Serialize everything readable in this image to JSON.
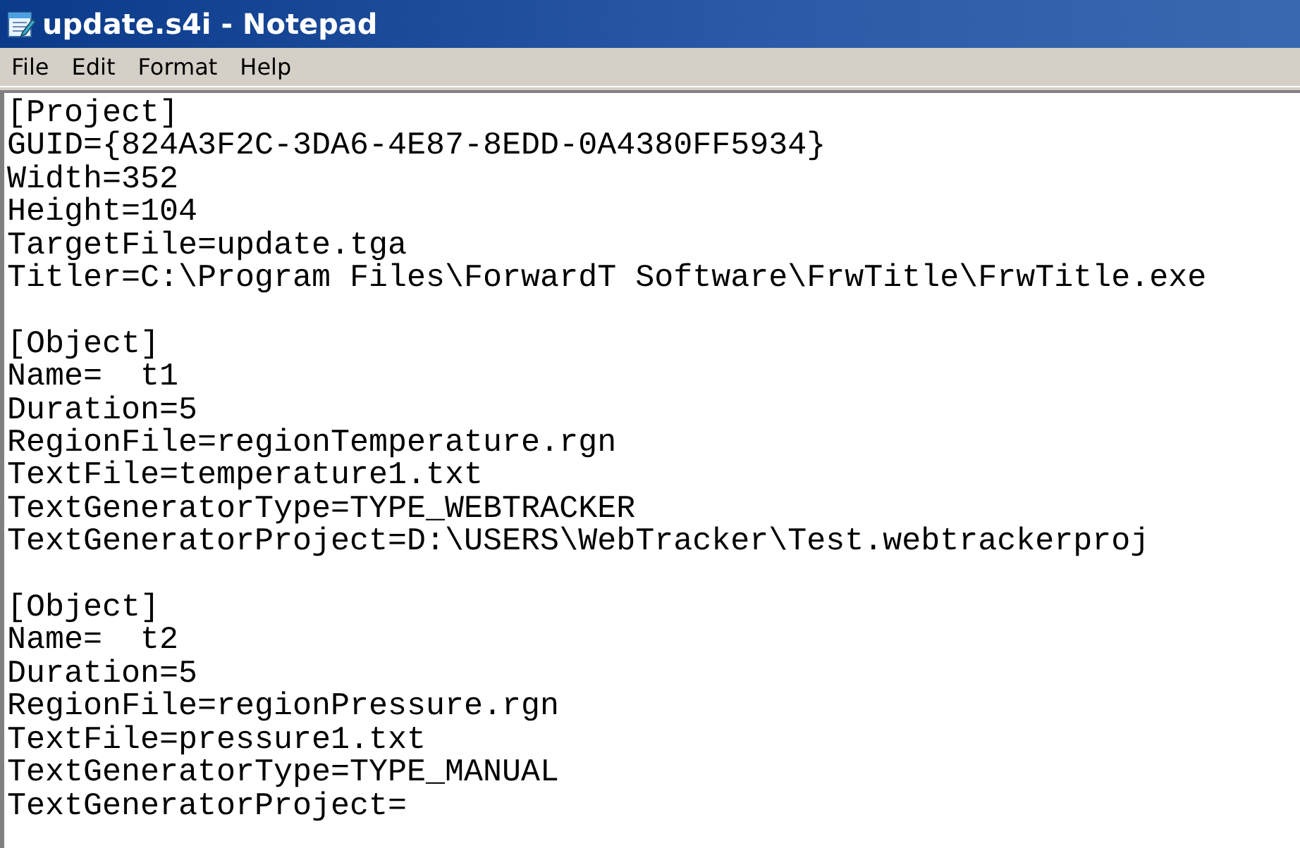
{
  "window": {
    "title": "update.s4i - Notepad"
  },
  "menu": [
    "File",
    "Edit",
    "Format",
    "Help"
  ],
  "sections": [
    {
      "lines": [
        "[Project]",
        "GUID={824A3F2C-3DA6-4E87-8EDD-0A4380FF5934}",
        "Width=352",
        "Height=104",
        "TargetFile=update.tga",
        "Titler=C:\\Program Files\\ForwardT Software\\FrwTitle\\FrwTitle.exe"
      ]
    },
    {
      "lines": [
        "[Object]",
        "Name=  t1",
        "Duration=5",
        "RegionFile=regionTemperature.rgn",
        "TextFile=temperature1.txt",
        "TextGeneratorType=TYPE_WEBTRACKER",
        "TextGeneratorProject=D:\\USERS\\WebTracker\\Test.webtrackerproj"
      ]
    },
    {
      "lines": [
        "[Object]",
        "Name=  t2",
        "Duration=5",
        "RegionFile=regionPressure.rgn",
        "TextFile=pressure1.txt",
        "TextGeneratorType=TYPE_MANUAL",
        "TextGeneratorProject="
      ]
    }
  ]
}
